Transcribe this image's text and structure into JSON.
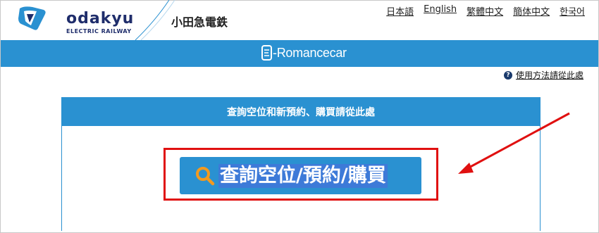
{
  "header": {
    "brand_name": "odakyu",
    "brand_tagline": "ELECTRIC RAILWAY",
    "company_name": "小田急電鉄"
  },
  "languages": [
    "日本語",
    "English",
    "繁體中文",
    "簡体中文",
    "한국어"
  ],
  "service": {
    "name": "-Romancecar"
  },
  "help": {
    "label": "使用方法請從此處"
  },
  "panel": {
    "title": "查詢空位和新預約、購買請從此處",
    "search_button_label": "查詢空位/預約/購買"
  },
  "colors": {
    "brand_blue": "#2a91d1",
    "highlight_red": "#e01010",
    "logo_navy": "#1f2d6b",
    "search_icon": "#f39a1e"
  }
}
